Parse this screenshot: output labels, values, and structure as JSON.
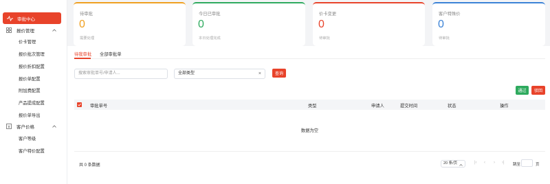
{
  "sidebar": {
    "active_item": "审批中心",
    "groups": [
      {
        "label": "报价管理",
        "items": [
          "价卡管理",
          "报价批次管理",
          "报价折扣配置",
          "报价单配置",
          "附加费配置",
          "产品提成配置",
          "报价单导出"
        ]
      },
      {
        "label": "客户价格",
        "items": [
          "客户等级",
          "客户特价配置"
        ]
      }
    ]
  },
  "stats": [
    {
      "title": "待审批",
      "value": "0",
      "desc": "需要处理",
      "color": "#f0a020"
    },
    {
      "title": "今日已审批",
      "value": "0",
      "desc": "本日处理完成",
      "color": "#2eaa5e"
    },
    {
      "title": "价卡变更",
      "value": "0",
      "desc": "待审批",
      "color": "#e8432a"
    },
    {
      "title": "客户特殊价",
      "value": "0",
      "desc": "待审批",
      "color": "#3b82d6"
    }
  ],
  "tabs": [
    "待我审批",
    "全部审批单"
  ],
  "filters": {
    "search_placeholder": "搜索审批单号/申请人...",
    "type_value": "全部类型",
    "clear_symbol": "×",
    "query_label": "查询"
  },
  "actions": {
    "approve_label": "通过",
    "reject_label": "驳回"
  },
  "table": {
    "columns": [
      "审批单号",
      "类型",
      "申请人",
      "提交时间",
      "状态",
      "操作"
    ],
    "empty_text": "数据为空"
  },
  "pagination": {
    "total_text": "共 0 条数据",
    "page_size": "20 条/页",
    "jump_label": "跳至",
    "page_label": "页"
  },
  "colors": {
    "accent": "#e8432a",
    "approve": "#2eaa5e",
    "reject": "#e8432a"
  }
}
